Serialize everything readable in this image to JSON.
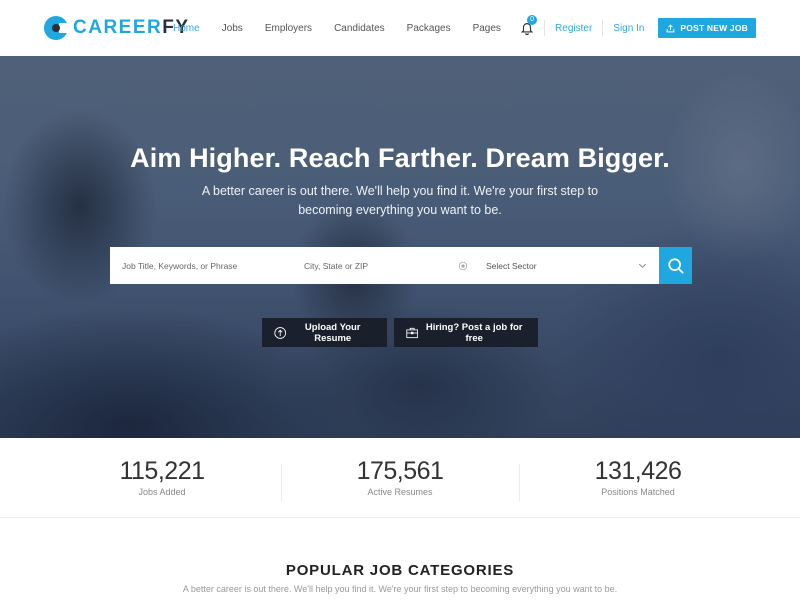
{
  "brand": {
    "name_primary": "CAREER",
    "name_secondary": "FY",
    "accent_color": "#1fa8e0",
    "dark_color": "#2a2f3a"
  },
  "nav": {
    "items": [
      {
        "label": "Home",
        "active": true
      },
      {
        "label": "Jobs",
        "active": false
      },
      {
        "label": "Employers",
        "active": false
      },
      {
        "label": "Candidates",
        "active": false
      },
      {
        "label": "Packages",
        "active": false
      },
      {
        "label": "Pages",
        "active": false
      }
    ]
  },
  "header": {
    "notification_icon": "bell-icon",
    "notification_count": "0",
    "register_label": "Register",
    "signin_label": "Sign In",
    "post_job_label": "POST NEW JOB",
    "post_job_icon": "upload-icon"
  },
  "hero": {
    "title": "Aim Higher. Reach Farther. Dream Bigger.",
    "subtitle": "A better career is out there. We'll help you find it. We're your first step to becoming everything you want to be.",
    "search": {
      "keywords_placeholder": "Job Title, Keywords, or Phrase",
      "location_placeholder": "City, State or ZIP",
      "location_icon": "locate-icon",
      "sector_selected": "Select Sector",
      "sector_icon": "chevron-down-icon",
      "submit_icon": "search-icon"
    },
    "cta": {
      "upload_label": "Upload Your Resume",
      "upload_icon": "upload-circle-icon",
      "hire_label": "Hiring? Post a job for free",
      "hire_icon": "briefcase-icon"
    }
  },
  "stats": [
    {
      "value": "115,221",
      "label": "Jobs Added"
    },
    {
      "value": "175,561",
      "label": "Active Resumes"
    },
    {
      "value": "131,426",
      "label": "Positions Matched"
    }
  ],
  "categories": {
    "title": "POPULAR JOB CATEGORIES",
    "subtitle": "A better career is out there. We'll help you find it. We're your first step to becoming everything you want to be."
  }
}
